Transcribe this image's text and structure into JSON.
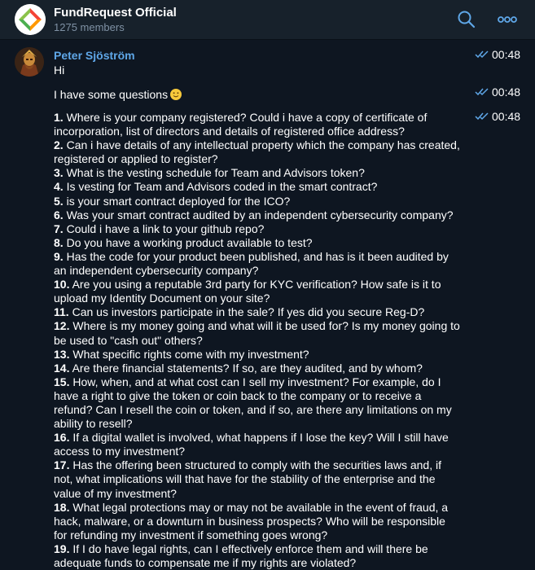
{
  "header": {
    "title": "FundRequest Official",
    "members": "1275 members"
  },
  "message": {
    "sender": "Peter Sjöström",
    "greeting": "Hi",
    "greeting_time": "00:48",
    "intro": "I have some questions",
    "intro_time": "00:48",
    "questions_time": "00:48",
    "questions": [
      {
        "num": "1.",
        "text": " Where is your company registered? Could i have a copy of certificate of incorporation, list of directors and details of registered office address?"
      },
      {
        "num": "2.",
        "text": " Can i have details of any intellectual property which the company has created, registered or applied to register?"
      },
      {
        "num": "3.",
        "text": " What is the vesting schedule for Team and Advisors token?"
      },
      {
        "num": "4.",
        "text": " Is vesting for Team and Advisors coded in the smart contract?"
      },
      {
        "num": "5.",
        "text": " is your smart contract deployed for the ICO?"
      },
      {
        "num": "6.",
        "text": " Was your smart contract audited by an independent cybersecurity company?"
      },
      {
        "num": "7.",
        "text": " Could i have a link to your github repo?"
      },
      {
        "num": "8.",
        "text": " Do you have a working product available to test?"
      },
      {
        "num": "9.",
        "text": " Has the code for your product been published, and has is it been audited by an independent cybersecurity company?"
      },
      {
        "num": "10.",
        "text": " Are you using a reputable 3rd party for KYC verification? How safe is it to upload my Identity Document on your site?"
      },
      {
        "num": "11.",
        "text": " Can us investors participate in the sale? If yes did you secure Reg-D?"
      },
      {
        "num": "12.",
        "text": " Where is my money going and what will it be used for?  Is my money going to be used to \"cash out\" others?"
      },
      {
        "num": "13.",
        "text": " What specific rights come with my investment?"
      },
      {
        "num": "14.",
        "text": " Are there financial statements?  If so, are they audited, and by whom?"
      },
      {
        "num": "15.",
        "text": " How, when, and at what cost can I sell my investment?  For example, do I have a right to give the token or coin back to the company or to receive a refund?  Can I resell the coin or token, and if so, are there any limitations on my ability to resell?"
      },
      {
        "num": "16.",
        "text": " If a digital wallet is involved, what happens if I lose the key?  Will I still have access to my investment?"
      },
      {
        "num": "17.",
        "text": " Has the offering been structured to comply with the securities laws and, if not, what implications will that have for the stability of the enterprise and the value of my investment?"
      },
      {
        "num": "18.",
        "text": " What legal protections may or may not be available in the event of fraud, a hack, malware, or a downturn in business prospects?  Who will be responsible for refunding my investment if something goes wrong?"
      },
      {
        "num": "19.",
        "text": " If I do have legal rights, can I effectively enforce them and will there be adequate funds to compensate me if my rights are violated?"
      }
    ]
  },
  "colors": {
    "background": "#0e1621",
    "header": "#17212b",
    "accent": "#5fa7e8",
    "subtext": "#7f91a4",
    "check": "#5fa7e8"
  },
  "icons": {
    "search": "search-icon",
    "more": "more-icon",
    "read_status": "double-check-icon"
  }
}
